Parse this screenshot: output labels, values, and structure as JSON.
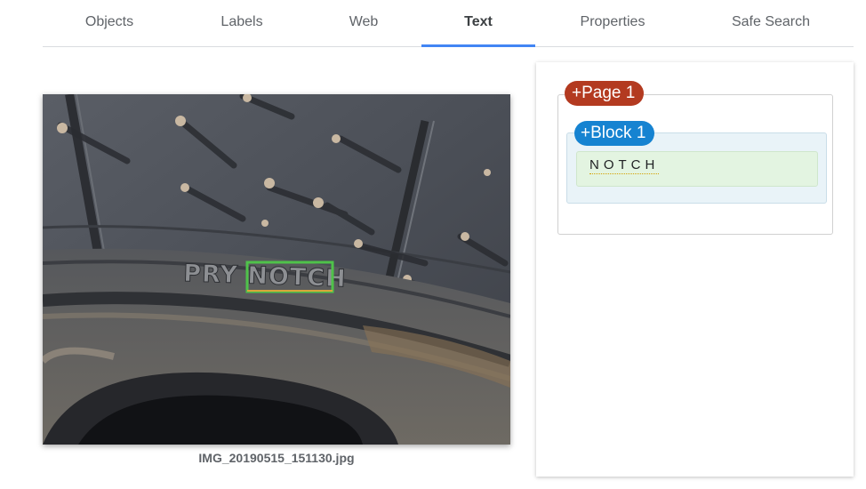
{
  "tabs": [
    {
      "label": "Objects"
    },
    {
      "label": "Labels"
    },
    {
      "label": "Web"
    },
    {
      "label": "Text"
    },
    {
      "label": "Properties"
    },
    {
      "label": "Safe Search"
    }
  ],
  "active_tab": "Text",
  "colors": {
    "tab_indicator": "#4285f4",
    "page_chip": "#b33a20",
    "block_chip": "#1683d1",
    "detection_box": "#4fc24a"
  },
  "image": {
    "filename": "IMG_20190515_151130.jpg",
    "embossed_text": "PRY NOTCH"
  },
  "results": {
    "page_label": "+Page 1",
    "block_label": "+Block 1",
    "word": "NOTCH"
  }
}
